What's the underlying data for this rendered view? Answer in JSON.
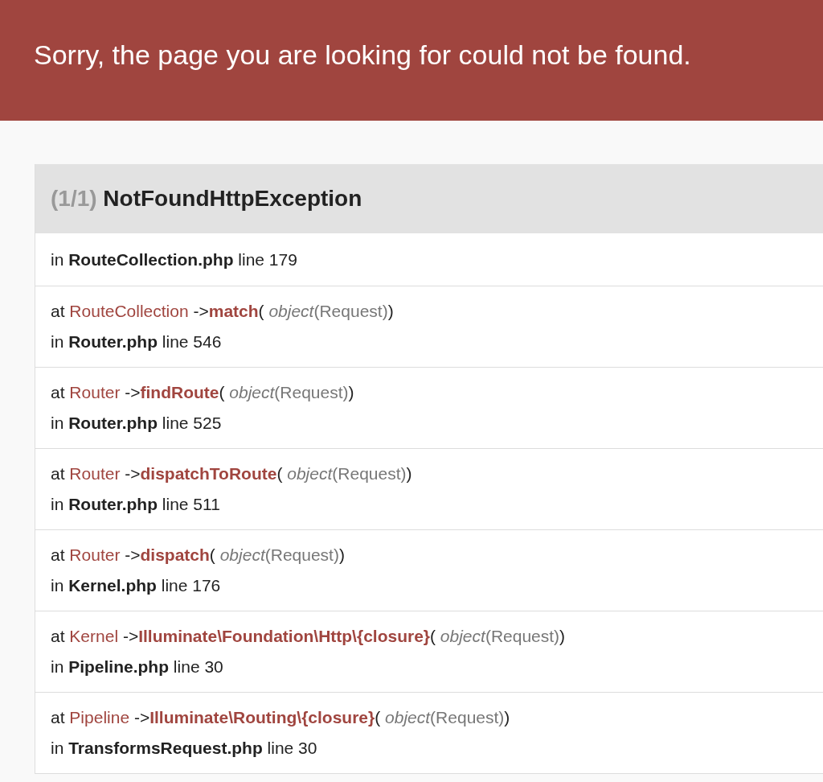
{
  "header": {
    "message": "Sorry, the page you are looking for could not be found."
  },
  "exception": {
    "count": "(1/1)",
    "name": "NotFoundHttpException"
  },
  "traces": [
    {
      "kind": "origin",
      "in": "in",
      "file": "RouteCollection.php",
      "line": "line 179"
    },
    {
      "kind": "call",
      "at": "at",
      "class": "RouteCollection",
      "arrow": "->",
      "method": "match",
      "open": "(",
      "arg_type": "object",
      "arg": "(Request)",
      "close": ")",
      "in": "in",
      "file": "Router.php",
      "line": "line 546"
    },
    {
      "kind": "call",
      "at": "at",
      "class": "Router",
      "arrow": "->",
      "method": "findRoute",
      "open": "(",
      "arg_type": "object",
      "arg": "(Request)",
      "close": ")",
      "in": "in",
      "file": "Router.php",
      "line": "line 525"
    },
    {
      "kind": "call",
      "at": "at",
      "class": "Router",
      "arrow": "->",
      "method": "dispatchToRoute",
      "open": "(",
      "arg_type": "object",
      "arg": "(Request)",
      "close": ")",
      "in": "in",
      "file": "Router.php",
      "line": "line 511"
    },
    {
      "kind": "call",
      "at": "at",
      "class": "Router",
      "arrow": "->",
      "method": "dispatch",
      "open": "(",
      "arg_type": "object",
      "arg": "(Request)",
      "close": ")",
      "in": "in",
      "file": "Kernel.php",
      "line": "line 176"
    },
    {
      "kind": "call",
      "at": "at",
      "class": "Kernel",
      "arrow": "->",
      "method": "Illuminate\\Foundation\\Http\\{closure}",
      "open": "(",
      "arg_type": "object",
      "arg": "(Request)",
      "close": ")",
      "in": "in",
      "file": "Pipeline.php",
      "line": "line 30"
    },
    {
      "kind": "call",
      "at": "at",
      "class": "Pipeline",
      "arrow": "->",
      "method": "Illuminate\\Routing\\{closure}",
      "open": "(",
      "arg_type": "object",
      "arg": "(Request)",
      "close": ")",
      "in": "in",
      "file": "TransformsRequest.php",
      "line": "line 30"
    }
  ]
}
